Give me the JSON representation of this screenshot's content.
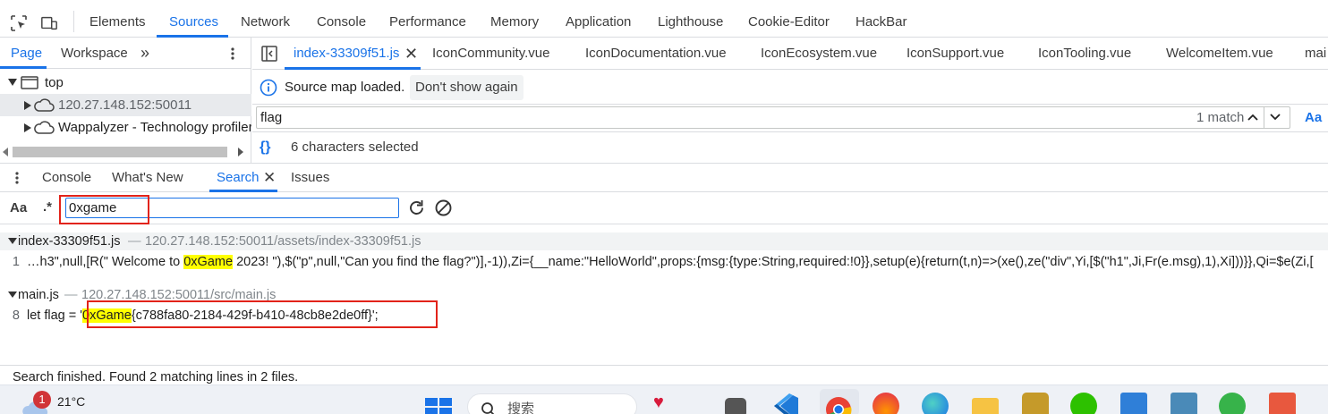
{
  "devtools_tabs": [
    "Elements",
    "Sources",
    "Network",
    "Console",
    "Performance",
    "Memory",
    "Application",
    "Lighthouse",
    "Cookie-Editor",
    "HackBar"
  ],
  "active_devtools_tab": "Sources",
  "navigator": {
    "tabs": [
      "Page",
      "Workspace"
    ],
    "more": "»",
    "tree": [
      {
        "label": "top"
      },
      {
        "label": "120.27.148.152:50011"
      },
      {
        "label": "Wappalyzer - Technology profiler"
      }
    ]
  },
  "editor": {
    "file_tabs": [
      "index-33309f51.js",
      "IconCommunity.vue",
      "IconDocumentation.vue",
      "IconEcosystem.vue",
      "IconSupport.vue",
      "IconTooling.vue",
      "WelcomeItem.vue",
      "mai"
    ],
    "info_message": "Source map loaded.",
    "dont_show": "Don't show again",
    "find_query": "flag",
    "find_count": "1 match",
    "case_toggle": "Aa",
    "status": "6 characters selected"
  },
  "drawer": {
    "tabs": [
      "Console",
      "What's New",
      "Search",
      "Issues"
    ],
    "active": "Search",
    "case_label": "Aa",
    "regex_label": ".*",
    "search_value": "0xgame"
  },
  "results": {
    "file1": {
      "name": "index-33309f51.js",
      "path": "120.27.148.152:50011/assets/index-33309f51.js",
      "line_no": "1",
      "pre": "…h3\",null,[R(\" Welcome to ",
      "match": "0xGame",
      "post": " 2023! \"),$(\"p\",null,\"Can you find the flag?\")],-1)),Zi={__name:\"HelloWorld\",props:{msg:{type:String,required:!0}},setup(e){return(t,n)=>(xe(),ze(\"div\",Yi,[$(\"h1\",Ji,Fr(e.msg),1),Xi]))}},Qi=$e(Zi,["
    },
    "file2": {
      "name": "main.js",
      "path": "120.27.148.152:50011/src/main.js",
      "line_no": "8",
      "pre": "let flag = '",
      "match": "0xGame",
      "post": "{c788fa80-2184-429f-b410-48cb8e2de0ff}';"
    }
  },
  "footer": "Search finished.  Found 2 matching lines in 2 files.",
  "taskbar": {
    "badge": "1",
    "temperature": "21°C",
    "search_placeholder": "搜索"
  },
  "colors": {
    "accent": "#1a73e8",
    "highlight": "#ffff00",
    "annotation": "#e2231a"
  }
}
